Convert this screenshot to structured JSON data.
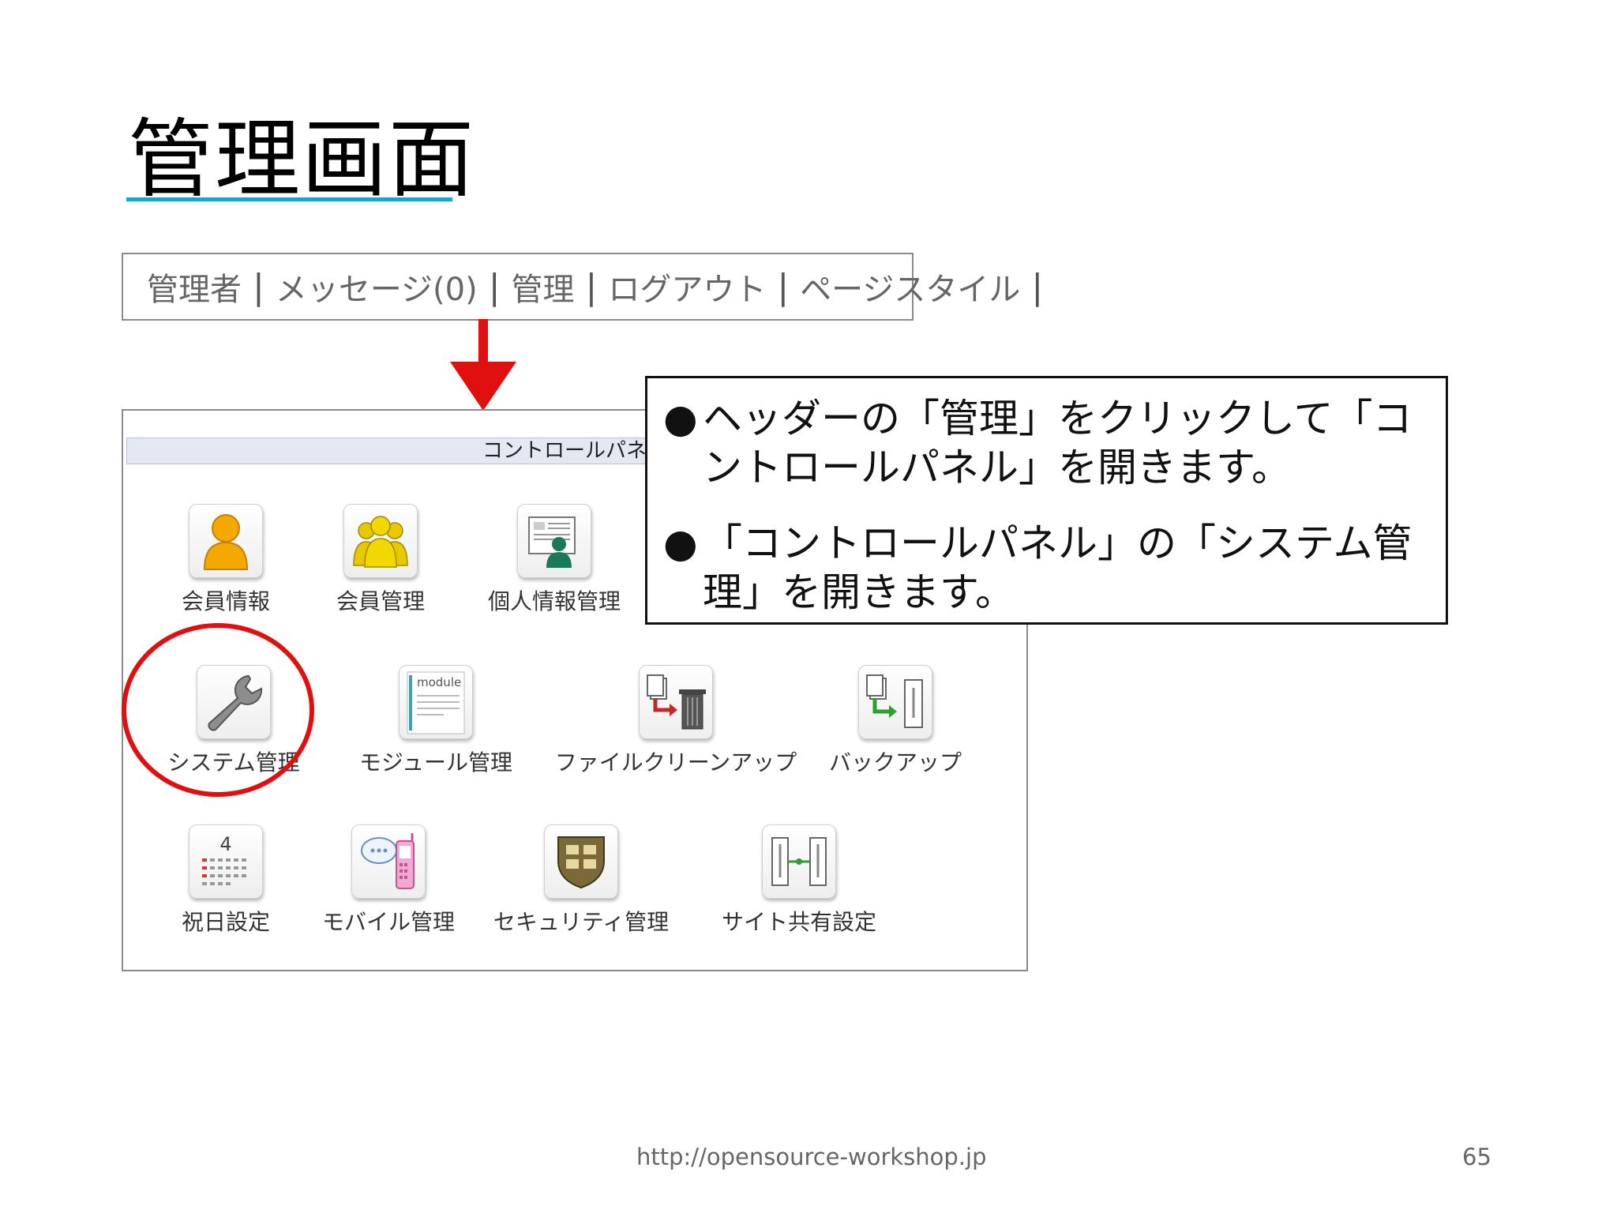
{
  "slide": {
    "title": "管理画面",
    "footer_url": "http://opensource-workshop.jp",
    "page_number": "65"
  },
  "header_bar": {
    "items": [
      "管理者",
      "メッセージ(0)",
      "管理",
      "ログアウト",
      "ページスタイル"
    ],
    "separator": "|"
  },
  "control_panel": {
    "title": "コントロールパネル",
    "tiles": [
      {
        "label": "会員情報",
        "icon": "user-icon"
      },
      {
        "label": "会員管理",
        "icon": "users-icon"
      },
      {
        "label": "個人情報管理",
        "icon": "personal-info-icon"
      },
      {
        "label": "システム管理",
        "icon": "wrench-icon"
      },
      {
        "label": "モジュール管理",
        "icon": "module-icon",
        "icon_text": "module"
      },
      {
        "label": "ファイルクリーンアップ",
        "icon": "file-cleanup-icon"
      },
      {
        "label": "バックアップ",
        "icon": "backup-icon"
      },
      {
        "label": "祝日設定",
        "icon": "calendar-icon",
        "icon_text": "4"
      },
      {
        "label": "モバイル管理",
        "icon": "mobile-icon"
      },
      {
        "label": "セキュリティ管理",
        "icon": "shield-icon"
      },
      {
        "label": "サイト共有設定",
        "icon": "site-share-icon"
      }
    ]
  },
  "callout": {
    "bullet_glyph": "●",
    "bullets": [
      "ヘッダーの「管理」をクリックして「コントロールパネル」を開きます。",
      "「コントロールパネル」の「システム管理」を開きます。"
    ]
  },
  "colors": {
    "title_underline": "#1ba0d8",
    "arrow": "#e01010",
    "highlight_circle": "#e01010",
    "panel_header_bg": "#e4e8f2"
  }
}
